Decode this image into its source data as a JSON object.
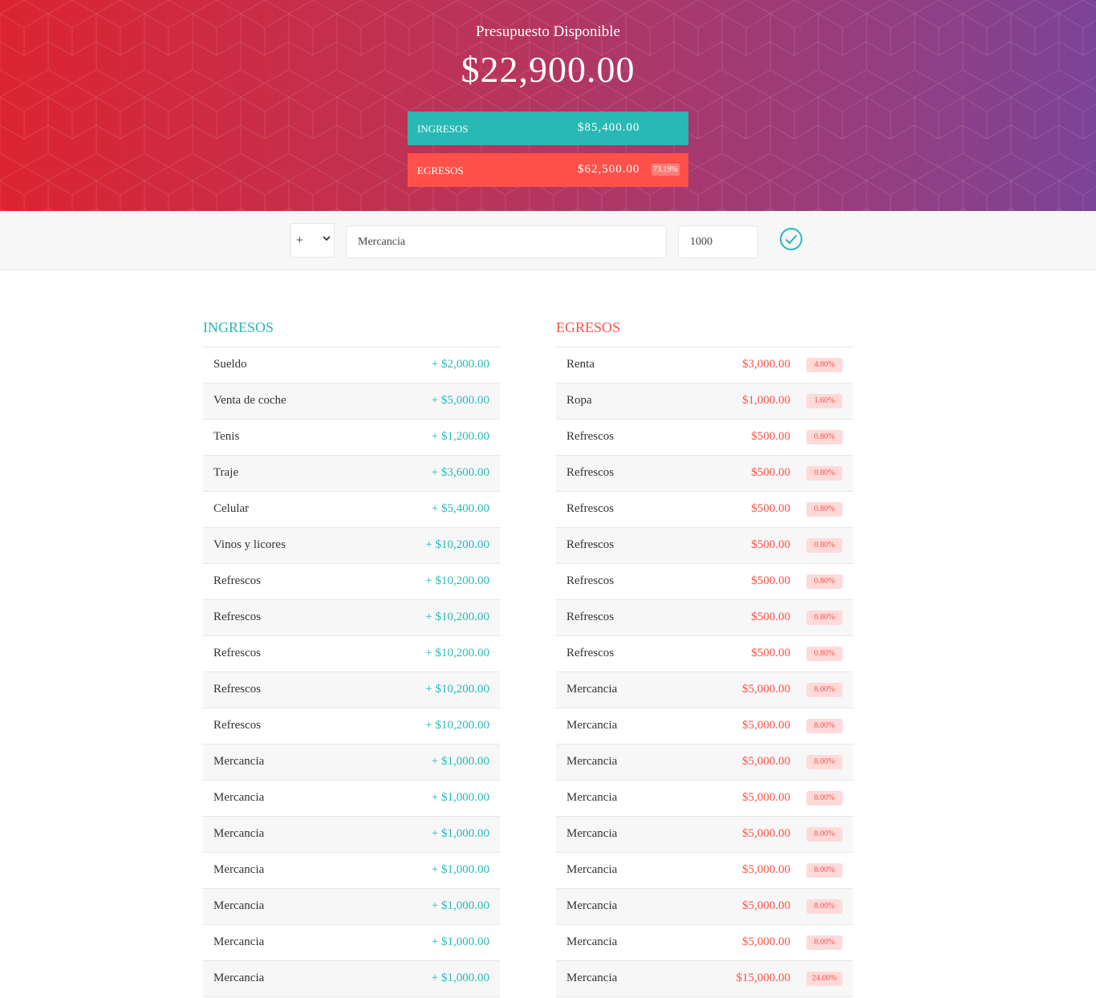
{
  "header": {
    "title": "Presupuesto Disponible",
    "budget": "$22,900.00",
    "income": {
      "label": "INGRESOS",
      "value": "$85,400.00"
    },
    "expenses": {
      "label": "EGRESOS",
      "value": "$62,500.00",
      "percentage": "73.19%"
    }
  },
  "add_form": {
    "type_value": "+",
    "description_value": "Mercancia",
    "value_value": "1000",
    "submit_icon": "check-circle-icon"
  },
  "colors": {
    "income": "#28b9b5",
    "expense": "#ff5049",
    "gradient_start": "#dc2430",
    "gradient_end": "#7b4397"
  },
  "income_list": {
    "title": "INGRESOS",
    "items": [
      {
        "description": "Sueldo",
        "amount": "+ $2,000.00"
      },
      {
        "description": "Venta de coche",
        "amount": "+ $5,000.00"
      },
      {
        "description": "Tenis",
        "amount": "+ $1,200.00"
      },
      {
        "description": "Traje",
        "amount": "+ $3,600.00"
      },
      {
        "description": "Celular",
        "amount": "+ $5,400.00"
      },
      {
        "description": "Vinos y licores",
        "amount": "+ $10,200.00"
      },
      {
        "description": "Refrescos",
        "amount": "+ $10,200.00"
      },
      {
        "description": "Refrescos",
        "amount": "+ $10,200.00"
      },
      {
        "description": "Refrescos",
        "amount": "+ $10,200.00"
      },
      {
        "description": "Refrescos",
        "amount": "+ $10,200.00"
      },
      {
        "description": "Refrescos",
        "amount": "+ $10,200.00"
      },
      {
        "description": "Mercancia",
        "amount": "+ $1,000.00"
      },
      {
        "description": "Mercancia",
        "amount": "+ $1,000.00"
      },
      {
        "description": "Mercancia",
        "amount": "+ $1,000.00"
      },
      {
        "description": "Mercancia",
        "amount": "+ $1,000.00"
      },
      {
        "description": "Mercancia",
        "amount": "+ $1,000.00"
      },
      {
        "description": "Mercancia",
        "amount": "+ $1,000.00"
      },
      {
        "description": "Mercancia",
        "amount": "+ $1,000.00"
      }
    ]
  },
  "expense_list": {
    "title": "EGRESOS",
    "items": [
      {
        "description": "Renta",
        "amount": "$3,000.00",
        "percentage": "4.80%"
      },
      {
        "description": "Ropa",
        "amount": "$1,000.00",
        "percentage": "1.60%"
      },
      {
        "description": "Refrescos",
        "amount": "$500.00",
        "percentage": "0.80%"
      },
      {
        "description": "Refrescos",
        "amount": "$500.00",
        "percentage": "0.80%"
      },
      {
        "description": "Refrescos",
        "amount": "$500.00",
        "percentage": "0.80%"
      },
      {
        "description": "Refrescos",
        "amount": "$500.00",
        "percentage": "0.80%"
      },
      {
        "description": "Refrescos",
        "amount": "$500.00",
        "percentage": "0.80%"
      },
      {
        "description": "Refrescos",
        "amount": "$500.00",
        "percentage": "0.80%"
      },
      {
        "description": "Refrescos",
        "amount": "$500.00",
        "percentage": "0.80%"
      },
      {
        "description": "Mercancia",
        "amount": "$5,000.00",
        "percentage": "8.00%"
      },
      {
        "description": "Mercancia",
        "amount": "$5,000.00",
        "percentage": "8.00%"
      },
      {
        "description": "Mercancia",
        "amount": "$5,000.00",
        "percentage": "8.00%"
      },
      {
        "description": "Mercancia",
        "amount": "$5,000.00",
        "percentage": "8.00%"
      },
      {
        "description": "Mercancia",
        "amount": "$5,000.00",
        "percentage": "8.00%"
      },
      {
        "description": "Mercancia",
        "amount": "$5,000.00",
        "percentage": "8.00%"
      },
      {
        "description": "Mercancia",
        "amount": "$5,000.00",
        "percentage": "8.00%"
      },
      {
        "description": "Mercancia",
        "amount": "$5,000.00",
        "percentage": "8.00%"
      },
      {
        "description": "Mercancia",
        "amount": "$15,000.00",
        "percentage": "24.00%"
      }
    ]
  }
}
